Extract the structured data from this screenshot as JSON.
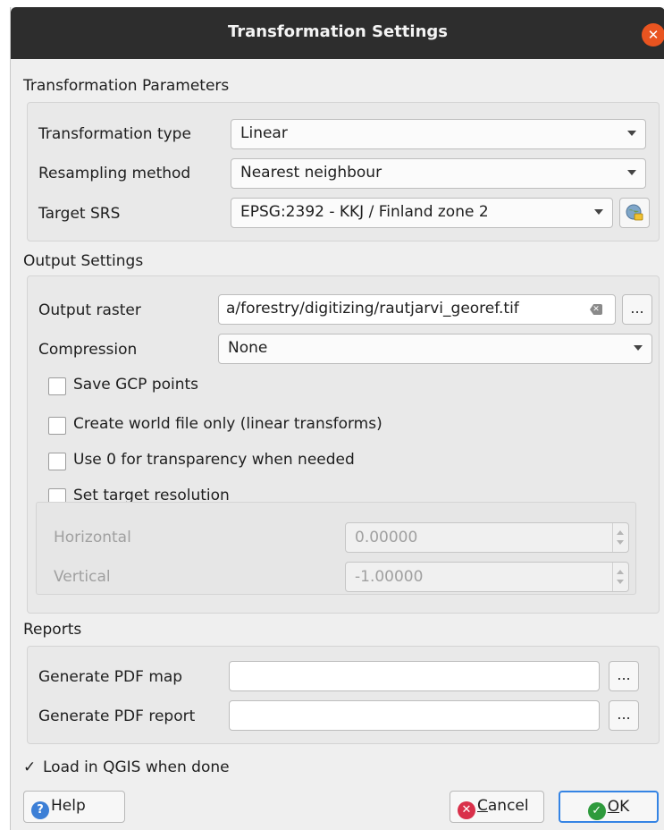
{
  "window": {
    "title": "Transformation Settings"
  },
  "transformation_parameters": {
    "heading": "Transformation Parameters",
    "transformation_type": {
      "label": "Transformation type",
      "value": "Linear"
    },
    "resampling_method": {
      "label": "Resampling method",
      "value": "Nearest neighbour"
    },
    "target_srs": {
      "label": "Target SRS",
      "value": "EPSG:2392 - KKJ / Finland zone 2"
    }
  },
  "output_settings": {
    "heading": "Output Settings",
    "output_raster": {
      "label": "Output raster",
      "value": "a/forestry/digitizing/rautjarvi_georef.tif",
      "browse": "..."
    },
    "compression": {
      "label": "Compression",
      "value": "None"
    },
    "save_gcp": {
      "label": "Save GCP points",
      "checked": false
    },
    "world_file_only": {
      "label": "Create world file only (linear transforms)",
      "checked": false
    },
    "use_zero_transparency": {
      "label": "Use 0 for transparency when needed",
      "checked": false
    },
    "set_target_resolution": {
      "label": "Set target resolution",
      "checked": false
    },
    "horizontal": {
      "label": "Horizontal",
      "value": "0.00000"
    },
    "vertical": {
      "label": "Vertical",
      "value": "-1.00000"
    }
  },
  "reports": {
    "heading": "Reports",
    "pdf_map": {
      "label": "Generate PDF map",
      "value": "",
      "browse": "..."
    },
    "pdf_report": {
      "label": "Generate PDF report",
      "value": "",
      "browse": "..."
    }
  },
  "load_in_qgis": {
    "label": "Load in QGIS when done",
    "checked": true,
    "mark": "✓"
  },
  "buttons": {
    "help": "Help",
    "cancel_prefix": "",
    "cancel_underline": "C",
    "cancel_rest": "ancel",
    "ok_underline": "O",
    "ok_rest": "K"
  },
  "colors": {
    "titlebar": "#2d2d2d",
    "close": "#e95420",
    "help_icon": "#3c7fd6",
    "cancel_icon": "#d9304a",
    "ok_icon": "#2e9a3c",
    "focus": "#3584e4"
  }
}
